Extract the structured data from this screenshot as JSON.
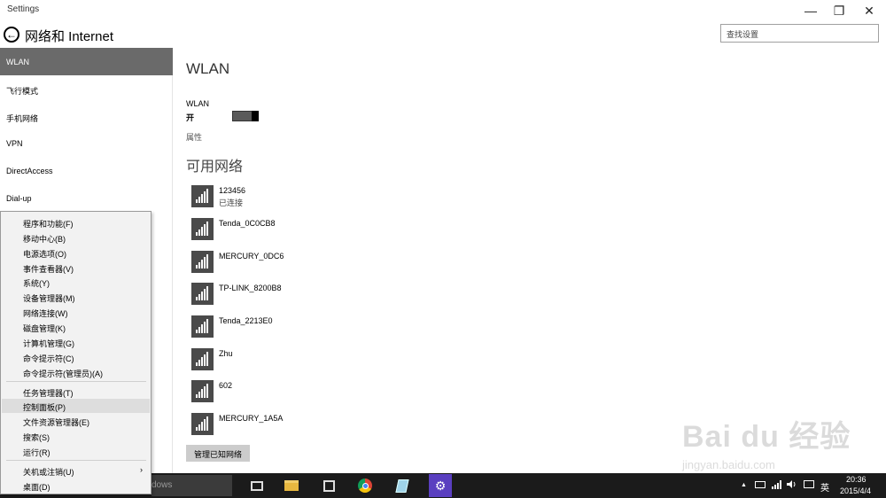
{
  "window": {
    "title": "Settings",
    "min": "—",
    "max": "❐",
    "close": "✕"
  },
  "header": {
    "back_glyph": "←",
    "title": "网络和 Internet",
    "search_placeholder": "查找设置"
  },
  "sidebar": {
    "items": [
      {
        "label": "WLAN",
        "active": true
      },
      {
        "label": "飞行模式"
      },
      {
        "label": "手机网络"
      },
      {
        "label": "VPN"
      },
      {
        "label": "DirectAccess"
      },
      {
        "label": "Dial-up"
      }
    ]
  },
  "context_menu": {
    "group1": [
      "程序和功能(F)",
      "移动中心(B)",
      "电源选项(O)",
      "事件查看器(V)",
      "系统(Y)",
      "设备管理器(M)",
      "网络连接(W)",
      "磁盘管理(K)",
      "计算机管理(G)",
      "命令提示符(C)",
      "命令提示符(管理员)(A)"
    ],
    "group2": [
      "任务管理器(T)",
      "控制面板(P)",
      "文件资源管理器(E)",
      "搜索(S)",
      "运行(R)"
    ],
    "group3": [
      "关机或注销(U)",
      "桌面(D)"
    ],
    "hovered": "控制面板(P)",
    "submenu_arrow": "›"
  },
  "main": {
    "title": "WLAN",
    "wlan_label": "WLAN",
    "wlan_state": "开",
    "wlan_on": true,
    "properties_link": "属性",
    "available_title": "可用网络",
    "networks": [
      {
        "name": "123456",
        "status": "已连接"
      },
      {
        "name": "Tenda_0C0CB8",
        "status": ""
      },
      {
        "name": "MERCURY_0DC6",
        "status": ""
      },
      {
        "name": "TP-LINK_8200B8",
        "status": ""
      },
      {
        "name": "Tenda_2213E0",
        "status": ""
      },
      {
        "name": "Zhu",
        "status": ""
      },
      {
        "name": "602",
        "status": ""
      },
      {
        "name": "MERCURY_1A5A",
        "status": ""
      }
    ],
    "manage_button": "管理已知网络"
  },
  "taskbar": {
    "search_text": "dows",
    "icons": [
      "task-view-icon",
      "file-explorer-icon",
      "store-icon",
      "chrome-icon",
      "notepad-icon",
      "settings-gear-icon"
    ],
    "tray": {
      "chevron": "▲",
      "ime": "英"
    },
    "time": "20:36",
    "date": "2015/4/4"
  },
  "watermark": {
    "logo": "Bai du 经验",
    "url": "jingyan.baidu.com"
  },
  "colors": {
    "sidebar_active": "#6a6a6a",
    "taskbar": "#1b1b1b",
    "net_icon": "#4a4a4a"
  }
}
